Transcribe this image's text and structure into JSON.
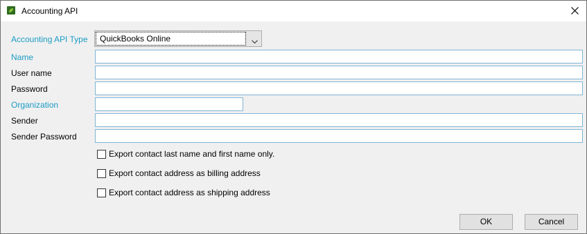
{
  "window": {
    "title": "Accounting API"
  },
  "form": {
    "api_type_label": "Accounting API Type",
    "api_type_value": "QuickBooks Online",
    "name_label": "Name",
    "name_value": "",
    "username_label": "User name",
    "username_value": "",
    "password_label": "Password",
    "password_value": "",
    "organization_label": "Organization",
    "organization_value": "",
    "sender_label": "Sender",
    "sender_value": "",
    "sender_password_label": "Sender Password",
    "sender_password_value": ""
  },
  "options": [
    {
      "label": "Export contact last name and first name only.",
      "checked": false
    },
    {
      "label": "Export contact address as billing address",
      "checked": false
    },
    {
      "label": "Export contact address as shipping address",
      "checked": false
    }
  ],
  "buttons": {
    "ok": "OK",
    "cancel": "Cancel"
  },
  "colors": {
    "required_label": "#1a9cc4",
    "window_bg": "#f0f0f0",
    "app_icon": "#2e6b1f"
  },
  "icons": {
    "app": "leaf-app-icon",
    "close": "close-icon",
    "dropdown": "chevron-down-icon"
  }
}
